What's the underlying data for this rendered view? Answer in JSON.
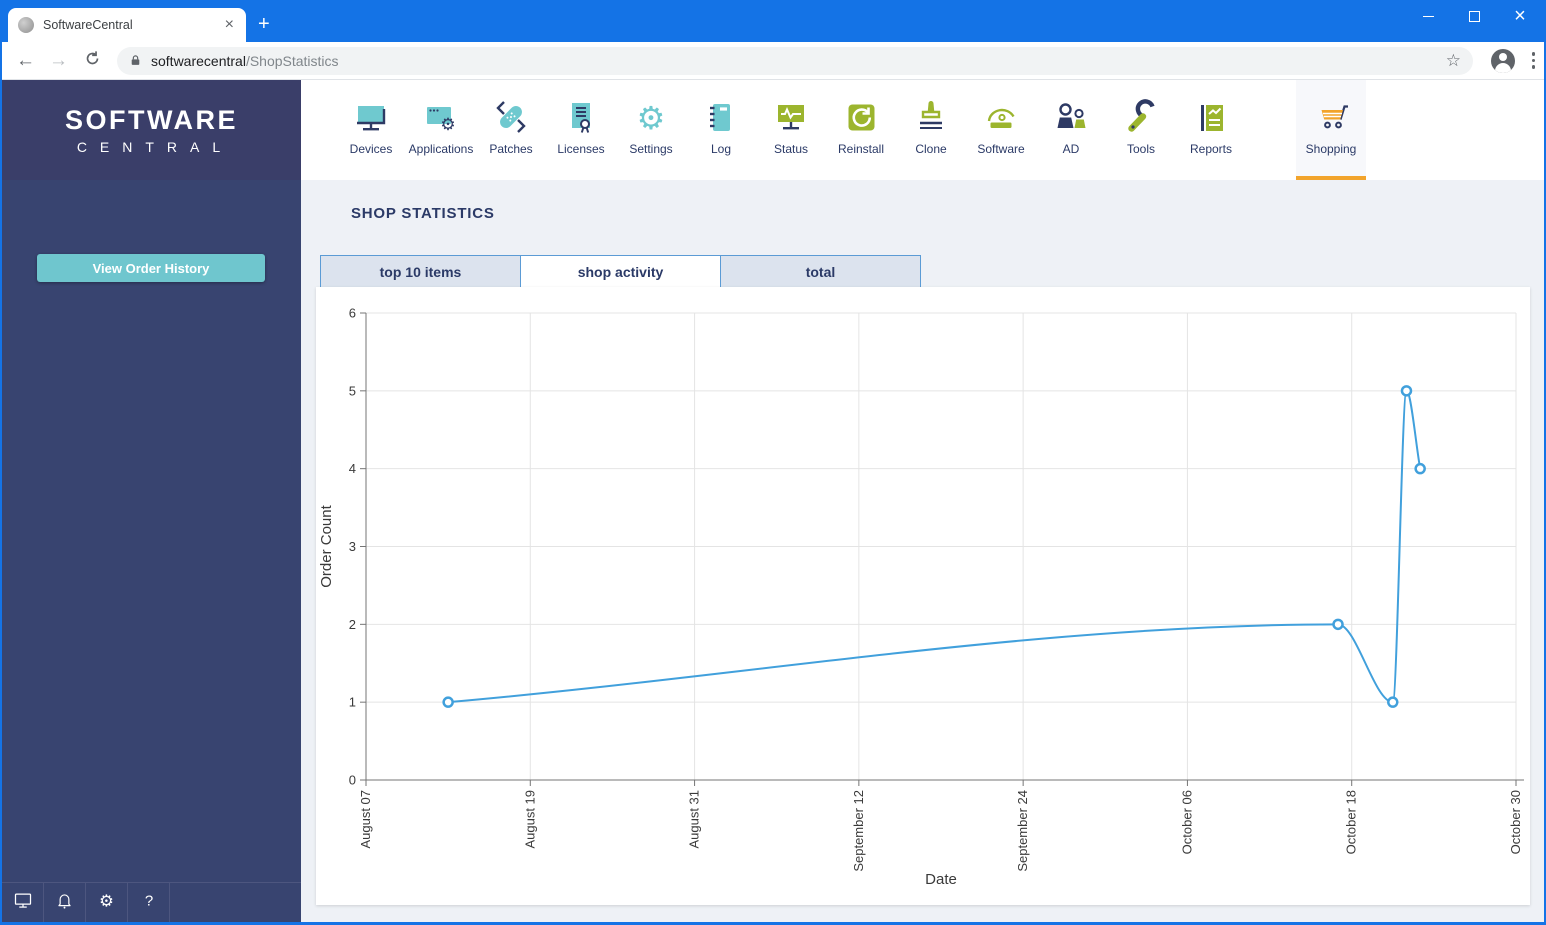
{
  "browser": {
    "tab_title": "SoftwareCentral",
    "url_host": "softwarecentral",
    "url_path": "/ShopStatistics"
  },
  "sidebar": {
    "logo_line1": "SOFTWARE",
    "logo_line2": "CENTRAL",
    "order_history_button": "View Order History",
    "footer_icons": [
      "monitor-icon",
      "bell-icon",
      "gear-icon",
      "help-icon"
    ]
  },
  "nav": {
    "items": [
      {
        "label": "Devices",
        "icon": "devices-icon"
      },
      {
        "label": "Applications",
        "icon": "applications-icon"
      },
      {
        "label": "Patches",
        "icon": "patches-icon"
      },
      {
        "label": "Licenses",
        "icon": "licenses-icon"
      },
      {
        "label": "Settings",
        "icon": "settings-icon"
      },
      {
        "label": "Log",
        "icon": "log-icon"
      },
      {
        "label": "Status",
        "icon": "status-icon"
      },
      {
        "label": "Reinstall",
        "icon": "reinstall-icon"
      },
      {
        "label": "Clone",
        "icon": "clone-icon"
      },
      {
        "label": "Software",
        "icon": "software-icon"
      },
      {
        "label": "AD",
        "icon": "ad-icon"
      },
      {
        "label": "Tools",
        "icon": "tools-icon"
      },
      {
        "label": "Reports",
        "icon": "reports-icon"
      },
      {
        "label": "Shopping",
        "icon": "shopping-icon",
        "active": true
      }
    ]
  },
  "page": {
    "title": "SHOP STATISTICS",
    "tabs": [
      {
        "label": "top 10 items"
      },
      {
        "label": "shop activity",
        "active": true
      },
      {
        "label": "total"
      }
    ]
  },
  "chart_data": {
    "type": "line",
    "xlabel": "Date",
    "ylabel": "Order Count",
    "ylim": [
      0,
      6
    ],
    "yticks": [
      0,
      1,
      2,
      3,
      4,
      5,
      6
    ],
    "xtick_labels": [
      "August 07",
      "August 19",
      "August 31",
      "September 12",
      "September 24",
      "October 06",
      "October 18",
      "October 30"
    ],
    "xtick_days": [
      0,
      12,
      24,
      36,
      48,
      60,
      72,
      84
    ],
    "grid": true,
    "legend": false,
    "series": [
      {
        "name": "shop activity",
        "points": [
          {
            "date": "August 13",
            "day": 6,
            "value": 1
          },
          {
            "date": "October 17",
            "day": 71,
            "value": 2
          },
          {
            "date": "October 21",
            "day": 75,
            "value": 1
          },
          {
            "date": "October 22",
            "day": 76,
            "value": 5
          },
          {
            "date": "October 23",
            "day": 77,
            "value": 4
          }
        ]
      }
    ]
  },
  "colors": {
    "titlebar_blue": "#1473E6",
    "sidebar_header": "#3A3E69",
    "sidebar_body": "#384470",
    "button_teal": "#6FC6CE",
    "icon_teal": "#6FC9CF",
    "icon_navy": "#2E3A64",
    "icon_green": "#9CB52E",
    "accent_orange": "#F2A42C",
    "tab_border_blue": "#5B9BD5",
    "chart_line": "#41A0DC",
    "grid_gray": "#e4e4e4",
    "axis_gray": "#757575",
    "label_gray": "#3a3a3a"
  }
}
